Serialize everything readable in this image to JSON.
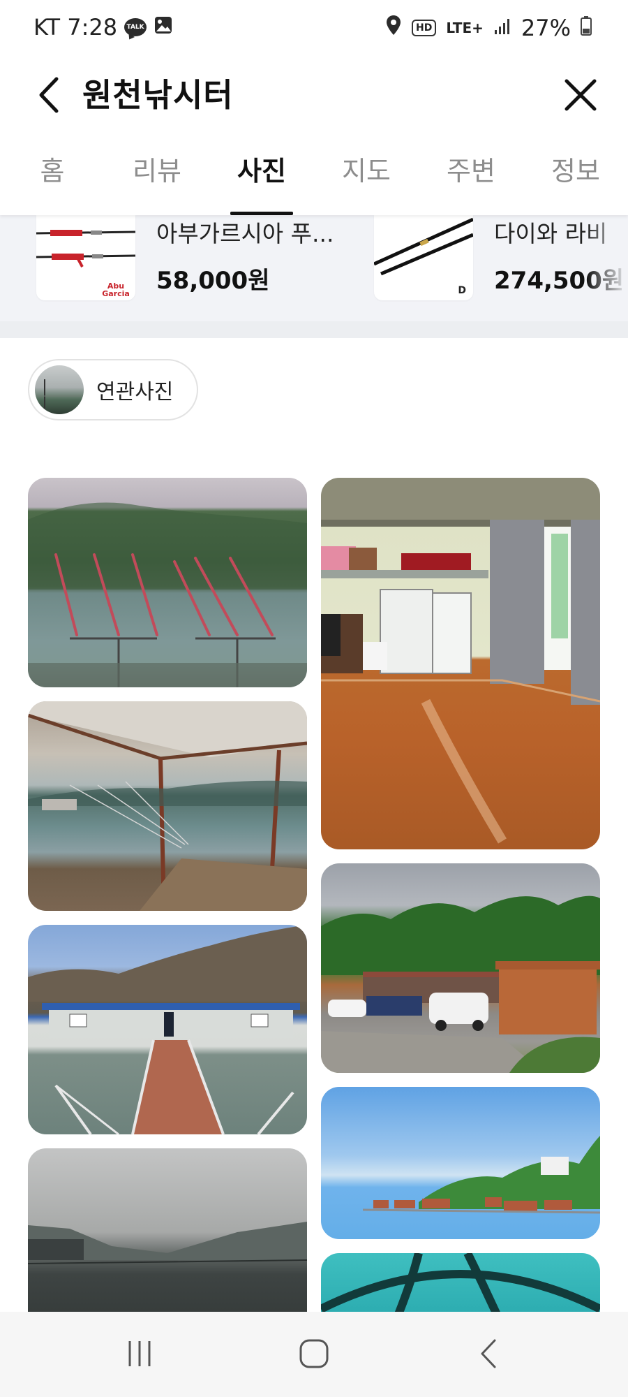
{
  "status_bar": {
    "carrier_time": "KT 7:28",
    "talk_badge": "TALK",
    "hd_label": "HD",
    "network_label": "LTE+",
    "battery_text": "27%",
    "icons": [
      "talk-icon",
      "gallery-icon",
      "location-icon",
      "hd-icon",
      "lte-icon",
      "signal-icon",
      "battery-icon"
    ]
  },
  "header": {
    "title": "원천낚시터",
    "back_icon": "back-arrow-icon",
    "close_icon": "close-icon"
  },
  "tabs": [
    {
      "label": "홈",
      "active": false
    },
    {
      "label": "리뷰",
      "active": false
    },
    {
      "label": "사진",
      "active": true
    },
    {
      "label": "지도",
      "active": false
    },
    {
      "label": "주변",
      "active": false
    },
    {
      "label": "정보",
      "active": false
    }
  ],
  "shopping": {
    "products": [
      {
        "name": "아부가르시아 푸...",
        "price": "58,000원",
        "brand_logo": "Abu Garcia"
      },
      {
        "name": "다이와 라비",
        "price": "274,500원",
        "brand_logo": "D"
      }
    ]
  },
  "related": {
    "label": "연관사진"
  },
  "gallery": {
    "photo_subjects": [
      "fishing-rods-on-lake",
      "room-with-refrigerator",
      "view-from-covered-dock",
      "parking-and-cabins",
      "floating-house-walkway",
      "lakeside-floating-cabins",
      "foggy-lake",
      "teal-dome-ceiling"
    ]
  },
  "nav_bar": {
    "icons": [
      "recent-apps-icon",
      "home-icon",
      "back-icon"
    ]
  },
  "colors": {
    "accent": "#111111",
    "inactive_tab": "#8d8d8d",
    "strip_bg": "#f2f3f7",
    "nav_bg": "#f6f6f6"
  }
}
